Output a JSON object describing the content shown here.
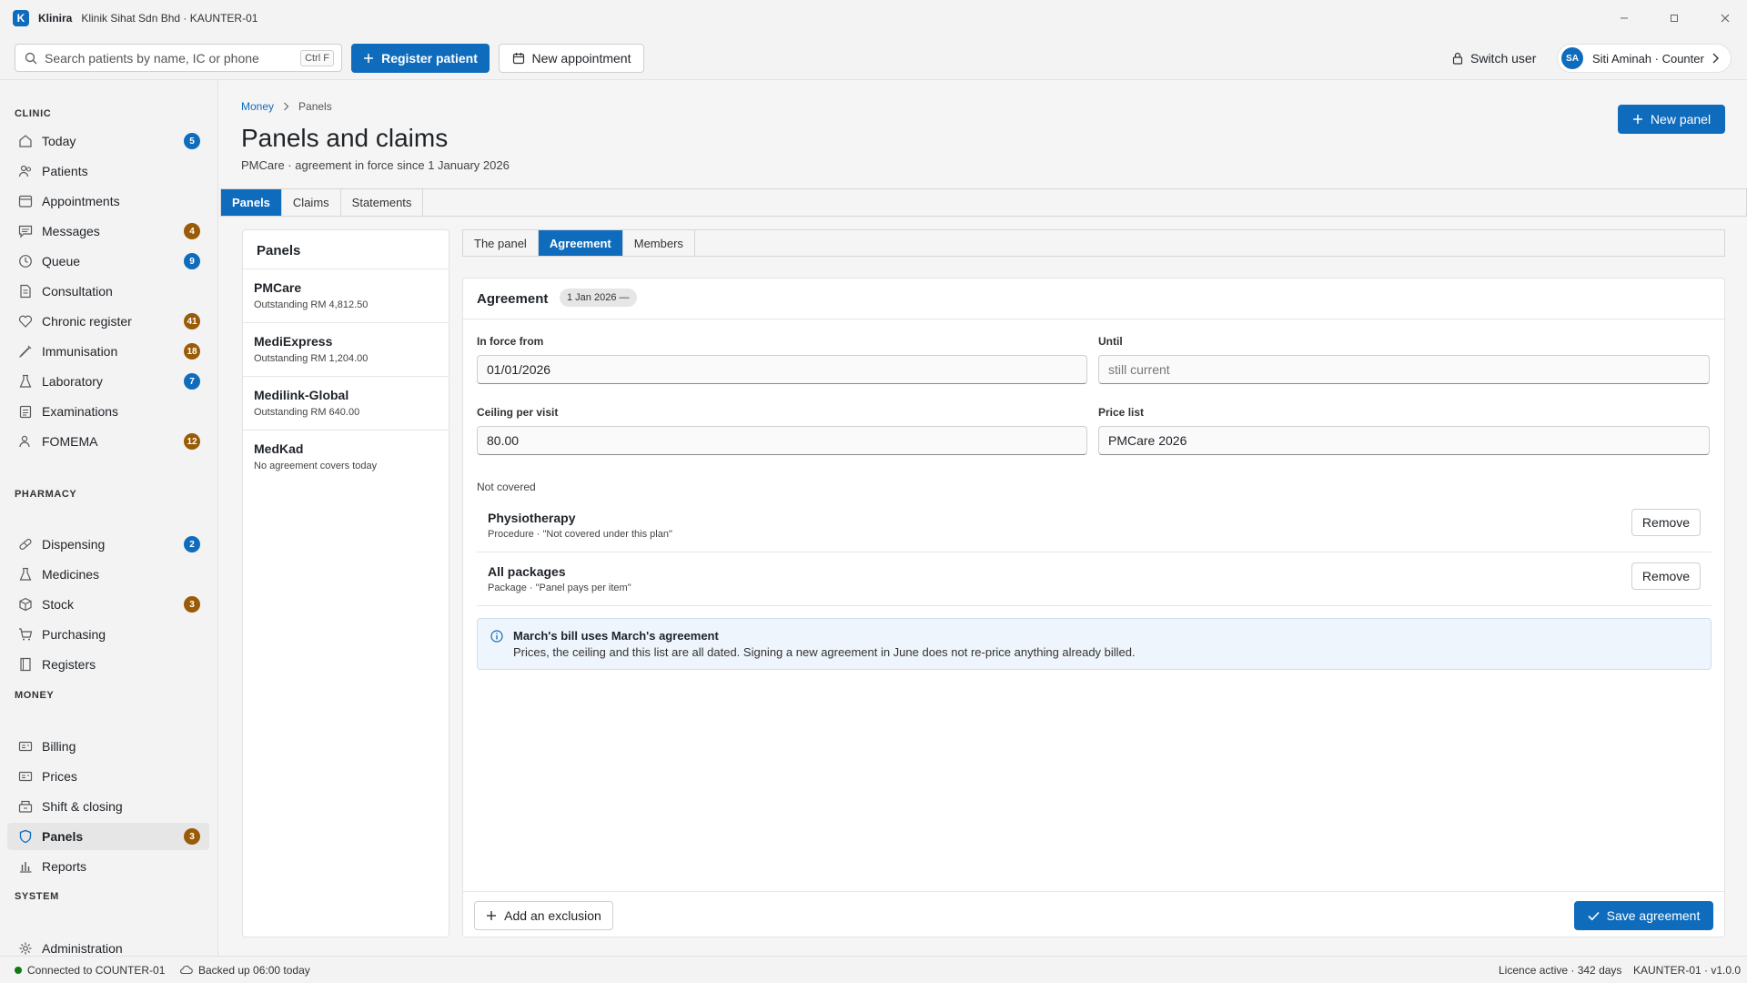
{
  "window": {
    "logo_letter": "K",
    "app_name": "Klinira",
    "subtitle": "Klinik Sihat Sdn Bhd · KAUNTER-01"
  },
  "toolbar": {
    "search_placeholder": "Search patients by name, IC or phone",
    "search_shortcut": "Ctrl F",
    "register_label": "Register patient",
    "appointment_label": "New appointment",
    "switch_user_label": "Switch user",
    "user_initials": "SA",
    "user_name": "Siti Aminah · Counter"
  },
  "sidebar": {
    "clinic_title": "CLINIC",
    "clinic_items": [
      {
        "label": "Today",
        "badge": "5",
        "badge_color": "blue"
      },
      {
        "label": "Patients"
      },
      {
        "label": "Appointments"
      },
      {
        "label": "Messages",
        "badge": "4",
        "badge_color": "brown"
      },
      {
        "label": "Queue",
        "badge": "9",
        "badge_color": "blue"
      },
      {
        "label": "Consultation"
      },
      {
        "label": "Chronic register",
        "badge": "41",
        "badge_color": "brown"
      },
      {
        "label": "Immunisation",
        "badge": "18",
        "badge_color": "brown"
      },
      {
        "label": "Laboratory",
        "badge": "7",
        "badge_color": "blue"
      },
      {
        "label": "Examinations"
      },
      {
        "label": "FOMEMA",
        "badge": "12",
        "badge_color": "brown"
      }
    ],
    "pharmacy_title": "PHARMACY",
    "pharmacy_items": [
      {
        "label": "Dispensing",
        "badge": "2",
        "badge_color": "blue"
      },
      {
        "label": "Medicines"
      },
      {
        "label": "Stock",
        "badge": "3",
        "badge_color": "brown"
      },
      {
        "label": "Purchasing"
      },
      {
        "label": "Registers"
      }
    ],
    "money_title": "MONEY",
    "money_items": [
      {
        "label": "Billing"
      },
      {
        "label": "Prices"
      },
      {
        "label": "Shift & closing"
      },
      {
        "label": "Panels",
        "badge": "3",
        "badge_color": "brown",
        "active": true
      },
      {
        "label": "Reports"
      }
    ],
    "system_title": "SYSTEM",
    "system_items": [
      {
        "label": "Administration"
      }
    ]
  },
  "main": {
    "breadcrumb": [
      "Money",
      "Panels"
    ],
    "title": "Panels and claims",
    "subtitle": "PMCare · agreement in force since 1 January 2026",
    "new_panel_label": "New panel",
    "tabs": [
      "Panels",
      "Claims",
      "Statements"
    ],
    "active_tab": "Panels"
  },
  "panels_list": {
    "title": "Panels",
    "items": [
      {
        "name": "PMCare",
        "sub": "Outstanding RM 4,812.50"
      },
      {
        "name": "MediExpress",
        "sub": "Outstanding RM 1,204.00"
      },
      {
        "name": "Medilink-Global",
        "sub": "Outstanding RM 640.00"
      },
      {
        "name": "MedKad",
        "sub": "No agreement covers today"
      }
    ]
  },
  "detail": {
    "tabs": [
      "The panel",
      "Agreement",
      "Members"
    ],
    "active_tab": "Agreement",
    "agreement_title": "Agreement",
    "agreement_chip": "1 Jan 2026 —",
    "in_force_label": "In force from",
    "in_force_value": "01/01/2026",
    "until_label": "Until",
    "until_placeholder": "still current",
    "ceiling_label": "Ceiling per visit",
    "ceiling_value": "80.00",
    "price_list_label": "Price list",
    "price_list_value": "PMCare 2026",
    "not_covered_label": "Not covered",
    "exclusions": [
      {
        "name": "Physiotherapy",
        "sub": "Procedure · \"Not covered under this plan\""
      },
      {
        "name": "All packages",
        "sub": "Package · \"Panel pays per item\""
      }
    ],
    "remove_label": "Remove",
    "info_title": "March's bill uses March's agreement",
    "info_text": "Prices, the ceiling and this list are all dated. Signing a new agreement in June does not re-price anything already billed.",
    "add_exclusion_label": "Add an exclusion",
    "save_label": "Save agreement"
  },
  "statusbar": {
    "connected": "Connected to COUNTER-01",
    "backup": "Backed up 06:00 today",
    "licence": "Licence active · 342 days",
    "version": "KAUNTER-01 · v1.0.0"
  },
  "colors": {
    "accent": "#0f6cbd",
    "badge_brown": "#9a5b08",
    "status_ok": "#107c10"
  }
}
